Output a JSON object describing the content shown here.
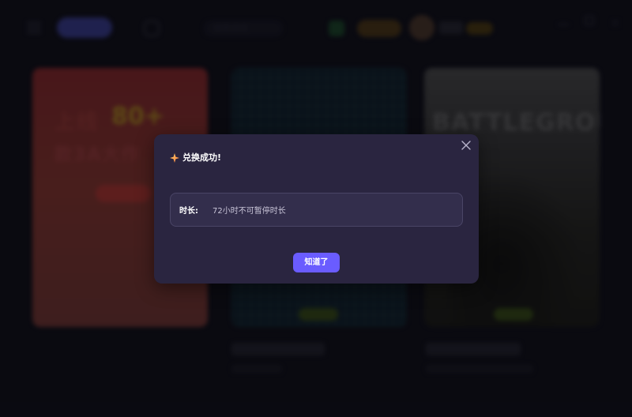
{
  "background_app": {
    "search_placeholder": "搜索游戏",
    "cards": [
      {
        "promo_line1": "上线",
        "promo_highlight": "80+",
        "promo_line2": "款3A大作"
      },
      {
        "title": "Steam特惠推荐",
        "subtitle": "限时折扣"
      },
      {
        "poster_text": "BATTLEGROUNDS",
        "title": "绝地求生大逃杀",
        "subtitle": "热门竞技游戏"
      }
    ]
  },
  "modal": {
    "title": "兑换成功!",
    "duration_label": "时长:",
    "duration_value": "72小时不可暂停时长",
    "confirm_label": "知道了",
    "colors": {
      "background": "#2a2540",
      "field_background": "#332e4c",
      "button": "#6a5cff"
    },
    "icons": {
      "title_icon": "sparkle-icon",
      "close": "close-icon"
    }
  }
}
